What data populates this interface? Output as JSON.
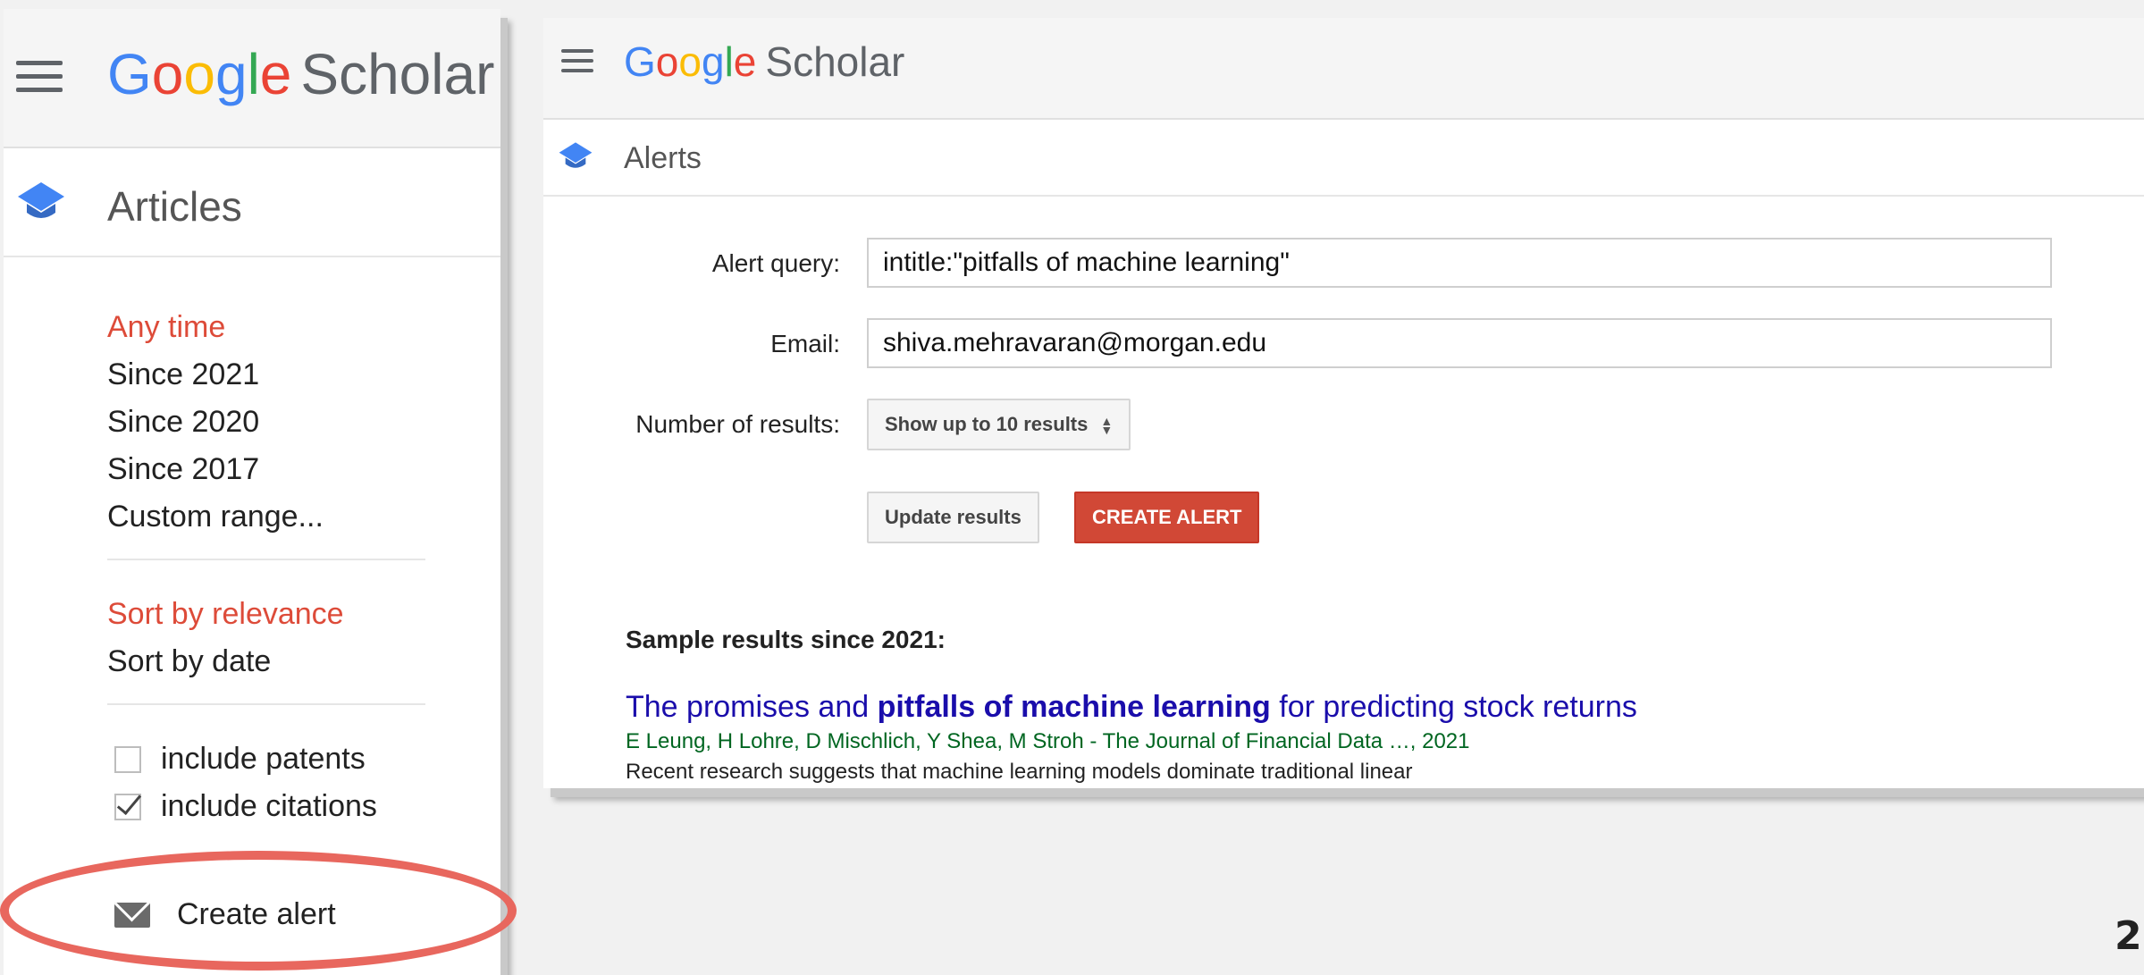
{
  "colors": {
    "accent_red": "#dd4b39",
    "link_blue": "#1a0dab",
    "author_green": "#006621",
    "button_red": "#d14836",
    "highlight": "#e8675e"
  },
  "logo": {
    "g1": "G",
    "o1": "o",
    "o2": "o",
    "g2": "g",
    "l": "l",
    "e": "e",
    "suffix": "Scholar"
  },
  "left": {
    "section_title": "Articles",
    "time_filters": [
      "Any time",
      "Since 2021",
      "Since 2020",
      "Since 2017",
      "Custom range..."
    ],
    "sort_options": [
      "Sort by relevance",
      "Sort by date"
    ],
    "include_patents": {
      "label": "include patents",
      "checked": false
    },
    "include_citations": {
      "label": "include citations",
      "checked": true
    },
    "create_alert": "Create alert",
    "icons": [
      "menu-icon",
      "graduation-cap-icon",
      "envelope-icon",
      "checkbox-icon"
    ]
  },
  "right": {
    "section_title": "Alerts",
    "alert_query_label": "Alert query:",
    "alert_query_value": "intitle:\"pitfalls of machine learning\"",
    "email_label": "Email:",
    "email_value": "shiva.mehravaran@morgan.edu",
    "num_results_label": "Number of results:",
    "num_results_value": "Show up to 10 results",
    "update_button": "Update results",
    "create_button": "CREATE ALERT",
    "sample_heading": "Sample results since 2021:",
    "result": {
      "title_pre": "The promises and ",
      "title_bold": "pitfalls of machine learning",
      "title_post": " for predicting stock returns",
      "authors": "E Leung, H Lohre, D Mischlich, Y Shea, M Stroh - The Journal of Financial Data …, 2021",
      "snippet": "Recent research suggests that machine learning models dominate traditional linear"
    }
  },
  "page_number": "2"
}
